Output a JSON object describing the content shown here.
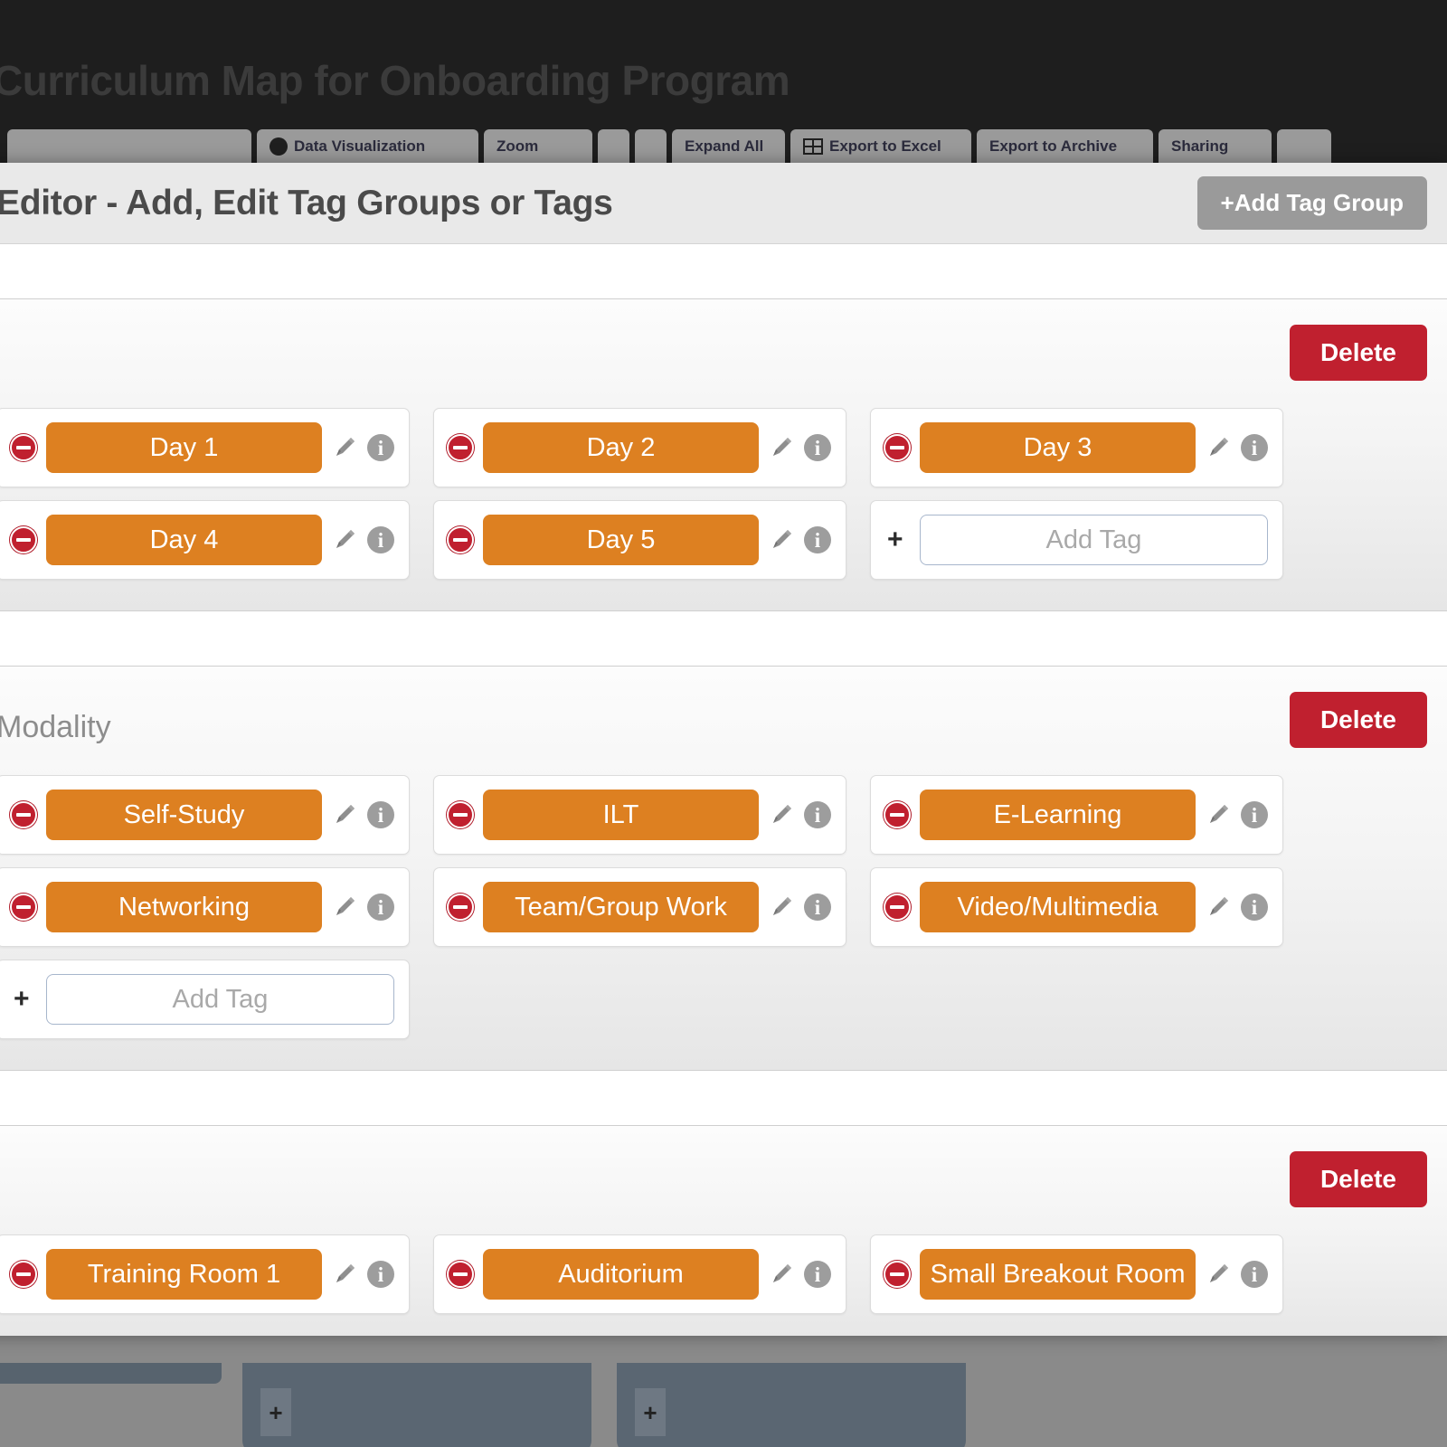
{
  "background": {
    "app_title": "Curriculum Map for Onboarding Program",
    "toolbar": [
      {
        "label": "",
        "icon": "none"
      },
      {
        "label": "Data Visualization",
        "icon": "circle-icon"
      },
      {
        "label": "Zoom",
        "icon": "none"
      },
      {
        "label": "",
        "icon": "none"
      },
      {
        "label": "",
        "icon": "none"
      },
      {
        "label": "Expand All",
        "icon": "none"
      },
      {
        "label": "Export to Excel",
        "icon": "grid-icon"
      },
      {
        "label": "Export to Archive",
        "icon": "none"
      },
      {
        "label": "Sharing",
        "icon": "none"
      },
      {
        "label": "",
        "icon": "none"
      }
    ],
    "card_add_label": "+"
  },
  "modal": {
    "title": "Editor - Add, Edit Tag Groups or Tags",
    "add_group_label": "+Add Tag Group",
    "delete_label": "Delete",
    "add_tag_placeholder": "Add Tag",
    "add_tag_value": "",
    "plus_label": "+",
    "info_label": "i",
    "groups": [
      {
        "title": "",
        "tags": [
          "Day 1",
          "Day 2",
          "Day 3",
          "Day 4",
          "Day 5"
        ]
      },
      {
        "title": "Modality",
        "tags": [
          "Self-Study",
          "ILT",
          "E-Learning",
          "Networking",
          "Team/Group Work",
          "Video/Multimedia"
        ]
      },
      {
        "title": "",
        "tags": [
          "Training Room 1",
          "Auditorium",
          "Small Breakout Room"
        ]
      }
    ]
  },
  "colors": {
    "tag_orange": "#dd8021",
    "delete_red": "#c0202f",
    "add_group_gray": "#9a9a9a",
    "topbar_dark": "#1e1e1e",
    "panel_slate": "#5a6672"
  }
}
